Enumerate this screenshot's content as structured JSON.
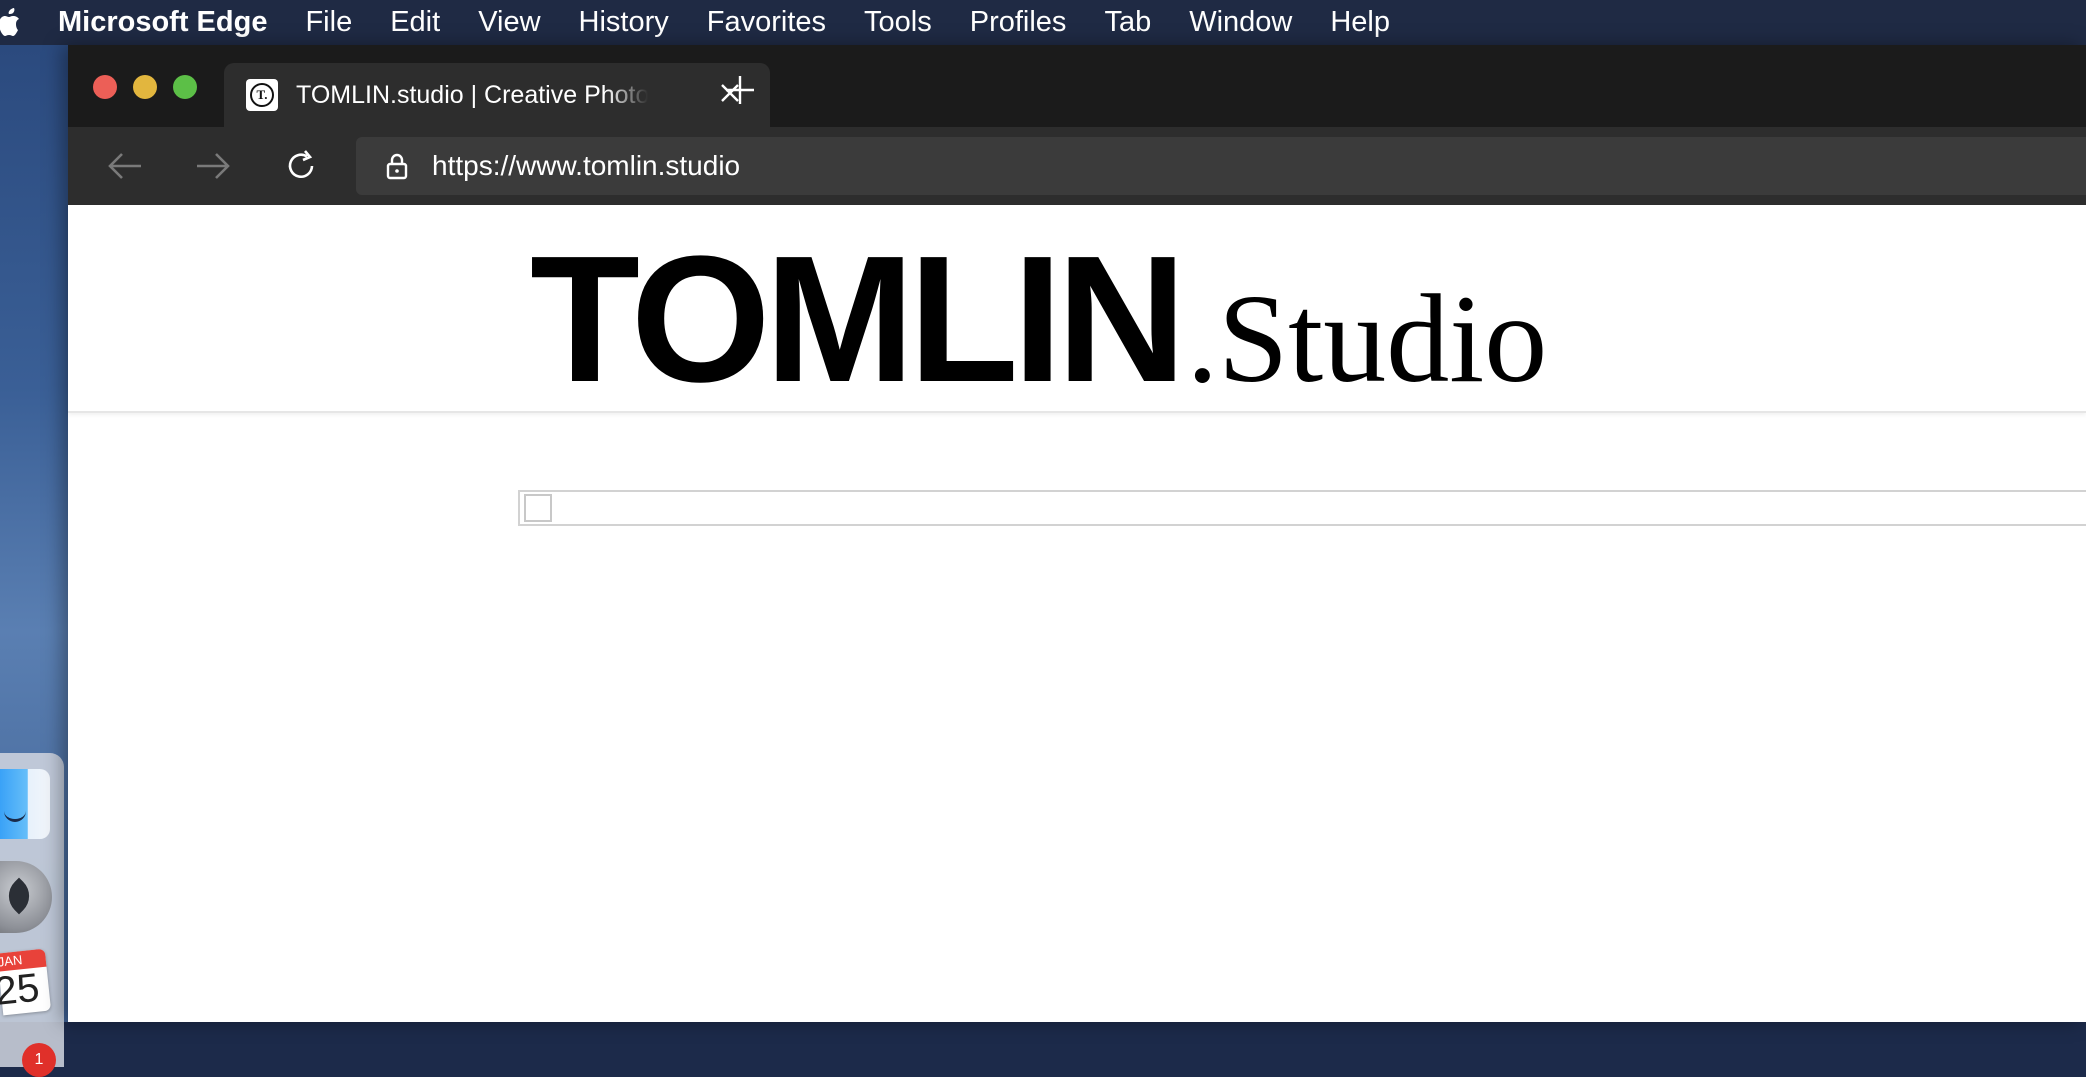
{
  "menubar": {
    "app_name": "Microsoft Edge",
    "items": [
      "File",
      "Edit",
      "View",
      "History",
      "Favorites",
      "Tools",
      "Profiles",
      "Tab",
      "Window",
      "Help"
    ]
  },
  "dock": {
    "calendar_month": "JAN",
    "calendar_day": "25",
    "badge_count": "1"
  },
  "browser": {
    "tab": {
      "title": "TOMLIN.studio | Creative Photography",
      "favicon_letter": "T."
    },
    "address": {
      "url": "https://www.tomlin.studio"
    }
  },
  "page": {
    "logo_bold": "TOMLIN",
    "logo_serif": ".Studio"
  },
  "colors": {
    "menubar": "#1f2a44",
    "tabbar": "#1b1b1b",
    "toolbar": "#2d2d2d",
    "close": "#ec5f57",
    "minimize": "#e2b63e",
    "maximize": "#5cbf47"
  }
}
